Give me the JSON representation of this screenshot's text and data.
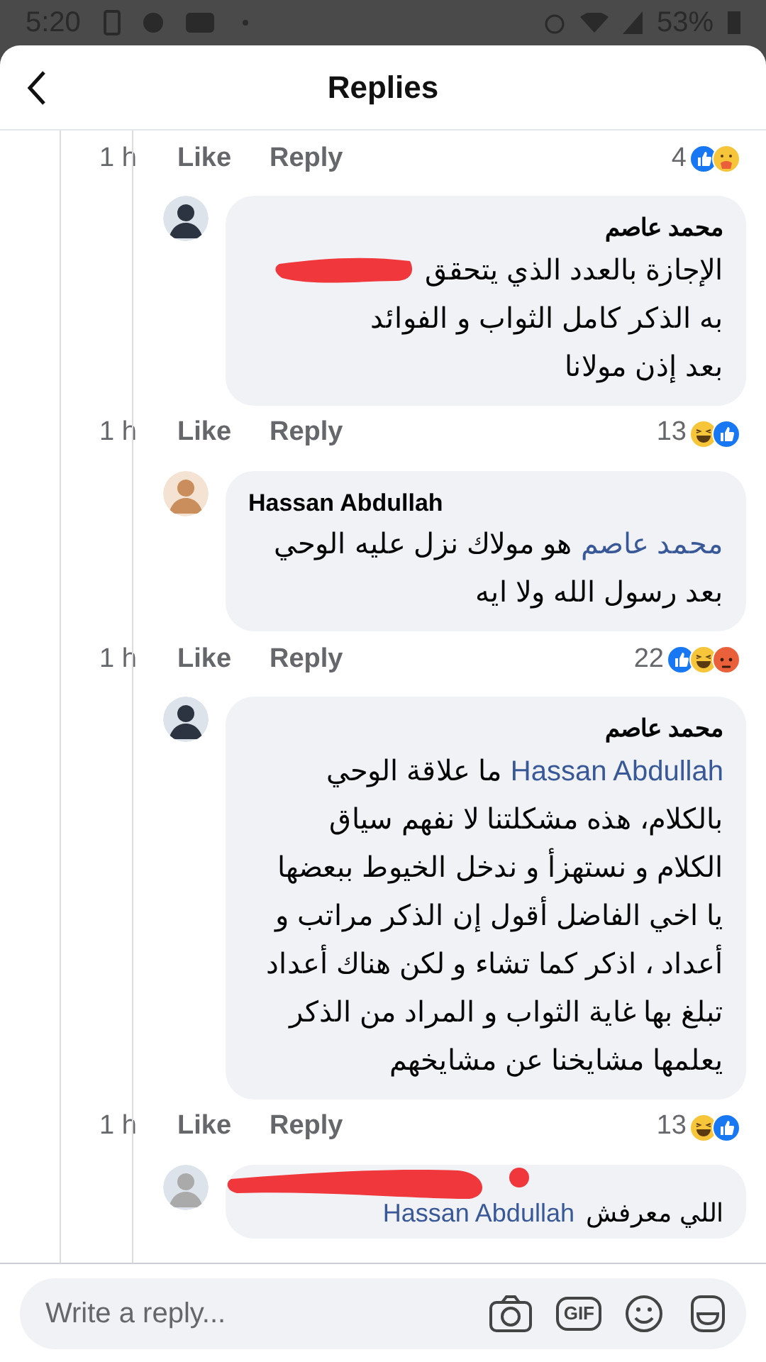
{
  "status_bar": {
    "time": "5:20",
    "battery": "53%"
  },
  "header": {
    "title": "Replies"
  },
  "top_actions": {
    "time": "1 h",
    "like": "Like",
    "reply": "Reply",
    "count": "4",
    "reactions": [
      {
        "kind": "like"
      },
      {
        "kind": "care"
      }
    ]
  },
  "comments": [
    {
      "author": "محمد عاصم",
      "redacted_mention": true,
      "lines": [
        "الإجازة بالعدد الذي يتحقق",
        "به الذكر كامل الثواب و الفوائد",
        "بعد إذن مولانا"
      ],
      "time": "1 h",
      "like": "Like",
      "reply": "Reply",
      "count": "13",
      "reactions": [
        {
          "kind": "haha"
        },
        {
          "kind": "like"
        }
      ]
    },
    {
      "author": "Hassan Abdullah",
      "mention": "محمد عاصم",
      "lines": [
        "هو مولاك نزل عليه الوحي",
        "بعد رسول الله ولا ايه"
      ],
      "time": "1 h",
      "like": "Like",
      "reply": "Reply",
      "count": "22",
      "reactions": [
        {
          "kind": "like"
        },
        {
          "kind": "haha"
        },
        {
          "kind": "angry"
        }
      ]
    },
    {
      "author": "محمد عاصم",
      "mention": "Hassan Abdullah",
      "lines": [
        "ما علاقة الوحي",
        "بالكلام، هذه مشكلتنا لا نفهم سياق",
        "الكلام و نستهزأ و ندخل الخيوط ببعضها",
        "يا اخي الفاضل أقول إن الذكر مراتب و",
        "أعداد ، اذكر كما تشاء و لكن هناك أعداد",
        "تبلغ بها غاية الثواب و المراد من الذكر",
        "يعلمها مشايخنا عن مشايخهم"
      ],
      "time": "1 h",
      "like": "Like",
      "reply": "Reply",
      "count": "13",
      "reactions": [
        {
          "kind": "haha"
        },
        {
          "kind": "like"
        }
      ]
    }
  ],
  "last_comment": {
    "mention": "Hassan Abdullah",
    "text": "اللي معرفش"
  },
  "composer": {
    "placeholder": "Write a reply...",
    "gif": "GIF"
  }
}
